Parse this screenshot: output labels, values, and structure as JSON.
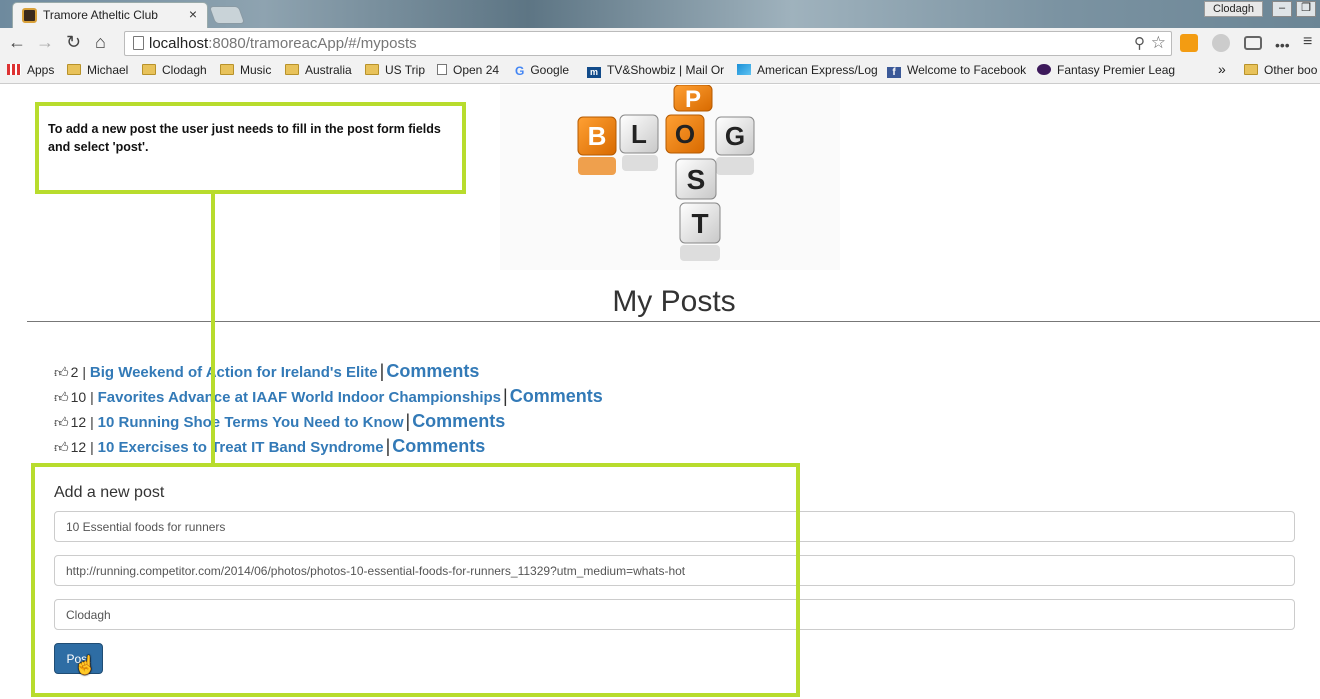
{
  "browser": {
    "tab_title": "Tramore Atheltic Club",
    "tab_close": "×",
    "user": "Clodagh",
    "url_host": "localhost",
    "url_path": ":8080/tramoreacApp/#/myposts"
  },
  "bookmarks": [
    {
      "label": "Apps",
      "icon": "apps-grid-icon"
    },
    {
      "label": "Michael",
      "icon": "folder-icon"
    },
    {
      "label": "Clodagh",
      "icon": "folder-icon"
    },
    {
      "label": "Music",
      "icon": "folder-icon"
    },
    {
      "label": "Australia",
      "icon": "folder-icon"
    },
    {
      "label": "US Trip",
      "icon": "folder-icon"
    },
    {
      "label": "Open 24",
      "icon": "page-icon"
    },
    {
      "label": "Google",
      "icon": "google-icon"
    },
    {
      "label": "TV&Showbiz | Mail Or",
      "icon": "mail-online-icon"
    },
    {
      "label": "American Express/Log",
      "icon": "amex-icon"
    },
    {
      "label": "Welcome to Facebook",
      "icon": "facebook-icon"
    },
    {
      "label": "Fantasy Premier Leag",
      "icon": "premier-league-icon"
    },
    {
      "label": "»",
      "icon": ""
    },
    {
      "label": "Other boo",
      "icon": "folder-icon"
    }
  ],
  "annotation": {
    "text": "To add a new post the user just needs to fill in the post form fields and select 'post'."
  },
  "logo_letters": {
    "blog": [
      "B",
      "L",
      "O",
      "G"
    ],
    "post": [
      "P",
      "O",
      "S",
      "T"
    ]
  },
  "page": {
    "title": "My Posts"
  },
  "posts": [
    {
      "likes": "2",
      "title": "Big Weekend of Action for Ireland's Elite",
      "comments": "Comments"
    },
    {
      "likes": "10",
      "title": "Favorites Advance at IAAF World Indoor Championships",
      "comments": "Comments"
    },
    {
      "likes": "12",
      "title": "10 Running Shoe Terms You Need to Know",
      "comments": "Comments"
    },
    {
      "likes": "12",
      "title": "10 Exercises to Treat IT Band Syndrome",
      "comments": "Comments"
    }
  ],
  "form": {
    "title": "Add a new post",
    "title_value": "10 Essential foods for runners",
    "link_value": "http://running.competitor.com/2014/06/photos/photos-10-essential-foods-for-runners_11329?utm_medium=whats-hot",
    "author_value": "Clodagh",
    "submit_label": "Post"
  },
  "colors": {
    "highlight": "#b8dc2d",
    "link": "#337ab7",
    "button": "#2e6da4"
  }
}
